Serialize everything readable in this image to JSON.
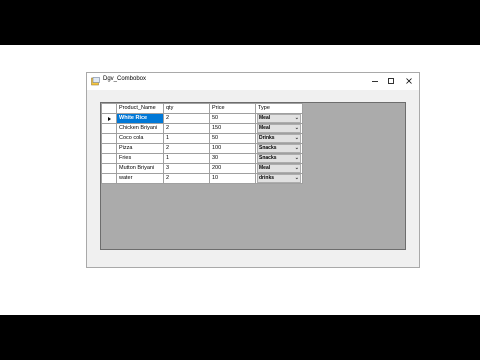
{
  "window": {
    "title": "Dgv_Combobox"
  },
  "grid": {
    "columns": [
      "Product_Name",
      "qty",
      "Price",
      "Type"
    ],
    "rows": [
      {
        "name": "White Rice",
        "qty": "2",
        "price": "50",
        "type": "Meal"
      },
      {
        "name": "Chicken Briyani",
        "qty": "2",
        "price": "150",
        "type": "Meal"
      },
      {
        "name": "Coco cola",
        "qty": "1",
        "price": "50",
        "type": "Drinks"
      },
      {
        "name": "Pizza",
        "qty": "2",
        "price": "100",
        "type": "Snacks"
      },
      {
        "name": "Fries",
        "qty": "1",
        "price": "30",
        "type": "Snacks"
      },
      {
        "name": "Mutton Briyani",
        "qty": "3",
        "price": "200",
        "type": "Meal"
      },
      {
        "name": "water",
        "qty": "2",
        "price": "10",
        "type": "drinks"
      }
    ]
  },
  "colors": {
    "selection": "#0078d7",
    "grid_background": "#ababab"
  },
  "icons": {
    "current_row": "row-pointer-icon",
    "dropdown": "chevron-down-icon"
  }
}
